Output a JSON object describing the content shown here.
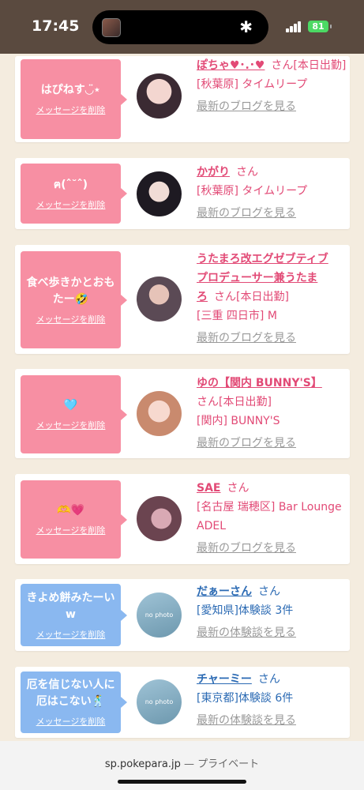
{
  "status": {
    "time": "17:45",
    "battery": "81"
  },
  "messages": [
    {
      "bubble_color": "pink",
      "message": "はぴねす◡̈⋆",
      "delete": "メッセージを削除",
      "name_line1": "ぽちゃ♥･.･♥",
      "name_line2": "",
      "san": "さん",
      "tag": "[本日出勤]",
      "shop": "[秋葉原] タイムリープ",
      "link": "最新のブログを見る",
      "name_color": "#e24a76"
    },
    {
      "bubble_color": "pink",
      "message": "ฅ(ˆ˘ˆ)",
      "delete": "メッセージを削除",
      "name_line1": "かがり",
      "san": "さん",
      "tag": "",
      "shop": "[秋葉原] タイムリープ",
      "link": "最新のブログを見る"
    },
    {
      "bubble_color": "pink",
      "message": "食べ歩きかとおもたー🤣",
      "delete": "メッセージを削除",
      "name_line1": "うたまろ改エグゼブティブ",
      "name_line2": "プロデューサー兼うたま",
      "name_line3": "ろ",
      "san": "さん",
      "tag": "[本日出勤]",
      "shop": "[三重 四日市] M",
      "link": "最新のブログを見る"
    },
    {
      "bubble_color": "pink",
      "message": "🩵",
      "delete": "メッセージを削除",
      "name_line1": "ゆの【関内 BUNNY'S】",
      "san": "さん",
      "tag": "[本日出勤]",
      "shop": "[関内] BUNNY'S",
      "link": "最新のブログを見る"
    },
    {
      "bubble_color": "pink",
      "message": "🫶💗",
      "delete": "メッセージを削除",
      "name_line1": "SAE",
      "san": "さん",
      "tag": "",
      "shop": "[名古屋 瑞穂区] Bar Lounge ADEL",
      "link": "最新のブログを見る"
    },
    {
      "bubble_color": "blue",
      "message": "きよめ餅みたーいw",
      "delete": "メッセージを削除",
      "name_line1": "だぁーさん",
      "san": "さん",
      "shop": "[愛知県]体験談 3件",
      "link": "最新の体験談を見る",
      "avatar_text": "no photo"
    },
    {
      "bubble_color": "blue",
      "message": "厄を信じない人に厄はこない🕺",
      "delete": "メッセージを削除",
      "name_line1": "チャーミー",
      "san": "さん",
      "shop": "[東京都]体験談 6件",
      "link": "最新の体験談を見る",
      "avatar_text": "no photo"
    }
  ],
  "browser": {
    "url": "sp.pokepara.jp",
    "separator": " — ",
    "mode": "プライベート"
  },
  "colors": {
    "pink_bubble": "#f78fa3",
    "blue_bubble": "#8ab8f0",
    "pink_text": "#e24a76",
    "blue_text": "#2c6bb4"
  }
}
